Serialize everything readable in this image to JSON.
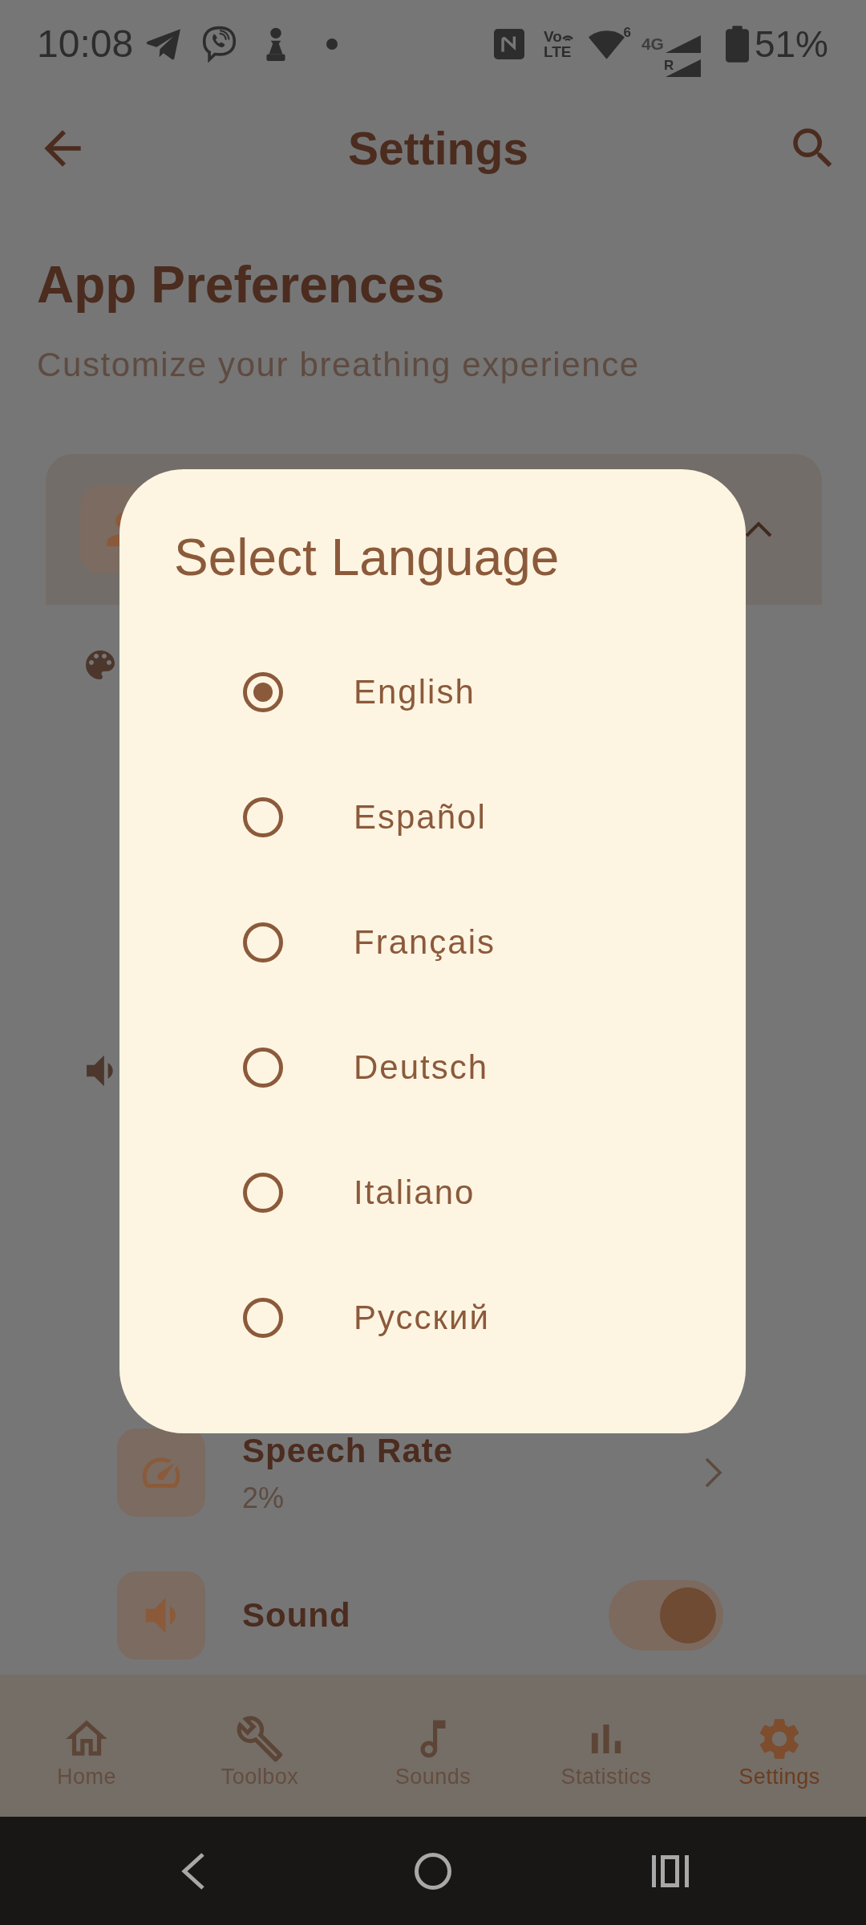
{
  "status_bar": {
    "time": "10:08",
    "volte": [
      "Vo",
      "LTE"
    ],
    "wifi_badge": "6",
    "network_type": "4G",
    "roaming": "R",
    "battery": "51%"
  },
  "app_bar": {
    "title": "Settings"
  },
  "page": {
    "title": "App Preferences",
    "subtitle": "Customize your breathing experience"
  },
  "settings_card": {
    "expanded": true,
    "rows": [
      {
        "kind": "link",
        "title": "Speech Rate",
        "value": "2%"
      },
      {
        "kind": "toggle",
        "title": "Sound",
        "on": true
      }
    ]
  },
  "bottom_nav": {
    "items": [
      {
        "label": "Home",
        "selected": false
      },
      {
        "label": "Toolbox",
        "selected": false
      },
      {
        "label": "Sounds",
        "selected": false
      },
      {
        "label": "Statistics",
        "selected": false
      },
      {
        "label": "Settings",
        "selected": true
      }
    ]
  },
  "language_dialog": {
    "title": "Select Language",
    "options": [
      {
        "label": "English",
        "selected": true
      },
      {
        "label": "Español",
        "selected": false
      },
      {
        "label": "Français",
        "selected": false
      },
      {
        "label": "Deutsch",
        "selected": false
      },
      {
        "label": "Italiano",
        "selected": false
      },
      {
        "label": "Русский",
        "selected": false
      }
    ]
  }
}
